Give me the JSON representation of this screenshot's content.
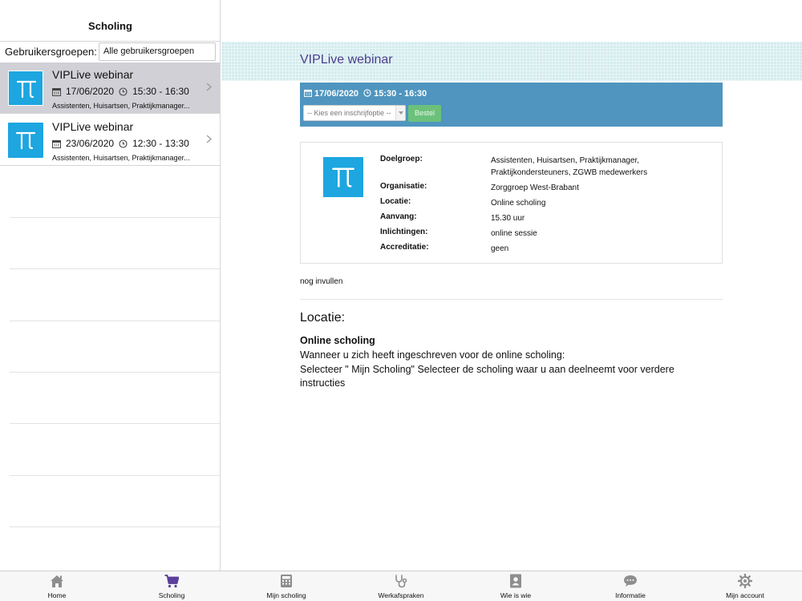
{
  "sidebar": {
    "title": "Scholing",
    "filter": {
      "label": "Gebruikersgroepen:",
      "value": "Alle gebruikersgroepen"
    },
    "events": [
      {
        "title": "VIPLive webinar",
        "date": "17/06/2020",
        "time": "15:30 - 16:30",
        "audience": "Assistenten, Huisartsen, Praktijkmanager...",
        "selected": true
      },
      {
        "title": "VIPLive webinar",
        "date": "23/06/2020",
        "time": "12:30 - 13:30",
        "audience": "Assistenten, Huisartsen, Praktijkmanager...",
        "selected": false
      }
    ]
  },
  "main": {
    "title": "VIPLive webinar",
    "bar": {
      "datetime_date": "17/06/2020",
      "datetime_time": "15:30 - 16:30",
      "select_placeholder": "-- Kies een inschrijfoptie --",
      "order_button": "Bestel"
    },
    "details": [
      {
        "key": "Doelgroep:",
        "value": "Assistenten, Huisartsen, Praktijkmanager, Praktijkondersteuners, ZGWB medewerkers"
      },
      {
        "key": "Organisatie:",
        "value": "Zorggroep West-Brabant"
      },
      {
        "key": "Locatie:",
        "value": "Online scholing"
      },
      {
        "key": "Aanvang:",
        "value": "15.30 uur"
      },
      {
        "key": "Inlichtingen:",
        "value": "online sessie"
      },
      {
        "key": "Accreditatie:",
        "value": "geen"
      }
    ],
    "note": "nog invullen",
    "locatie": {
      "heading": "Locatie:",
      "subheading": "Online scholing",
      "line1": "Wanneer u zich heeft ingeschreven voor de online scholing:",
      "line2": "Selecteer \" Mijn Scholing\" Selecteer de scholing waar u aan deelneemt voor verdere instructies"
    }
  },
  "tabbar": {
    "tabs": [
      {
        "label": "Home",
        "icon": "home-icon",
        "active": false
      },
      {
        "label": "Scholing",
        "icon": "cart-icon",
        "active": true
      },
      {
        "label": "Mijn scholing",
        "icon": "calculator-icon",
        "active": false
      },
      {
        "label": "Werkafspraken",
        "icon": "stethoscope-icon",
        "active": false
      },
      {
        "label": "Wie is wie",
        "icon": "contact-card-icon",
        "active": false
      },
      {
        "label": "Informatie",
        "icon": "chat-bubble-icon",
        "active": false
      },
      {
        "label": "Mijn account",
        "icon": "gear-icon",
        "active": false
      }
    ]
  },
  "colors": {
    "accent_purple": "#5b3f9b",
    "logo_blue": "#1da6e0",
    "bar_blue": "#4f95bf",
    "button_green": "#6cc17a",
    "header_tint": "#d4ecef"
  }
}
